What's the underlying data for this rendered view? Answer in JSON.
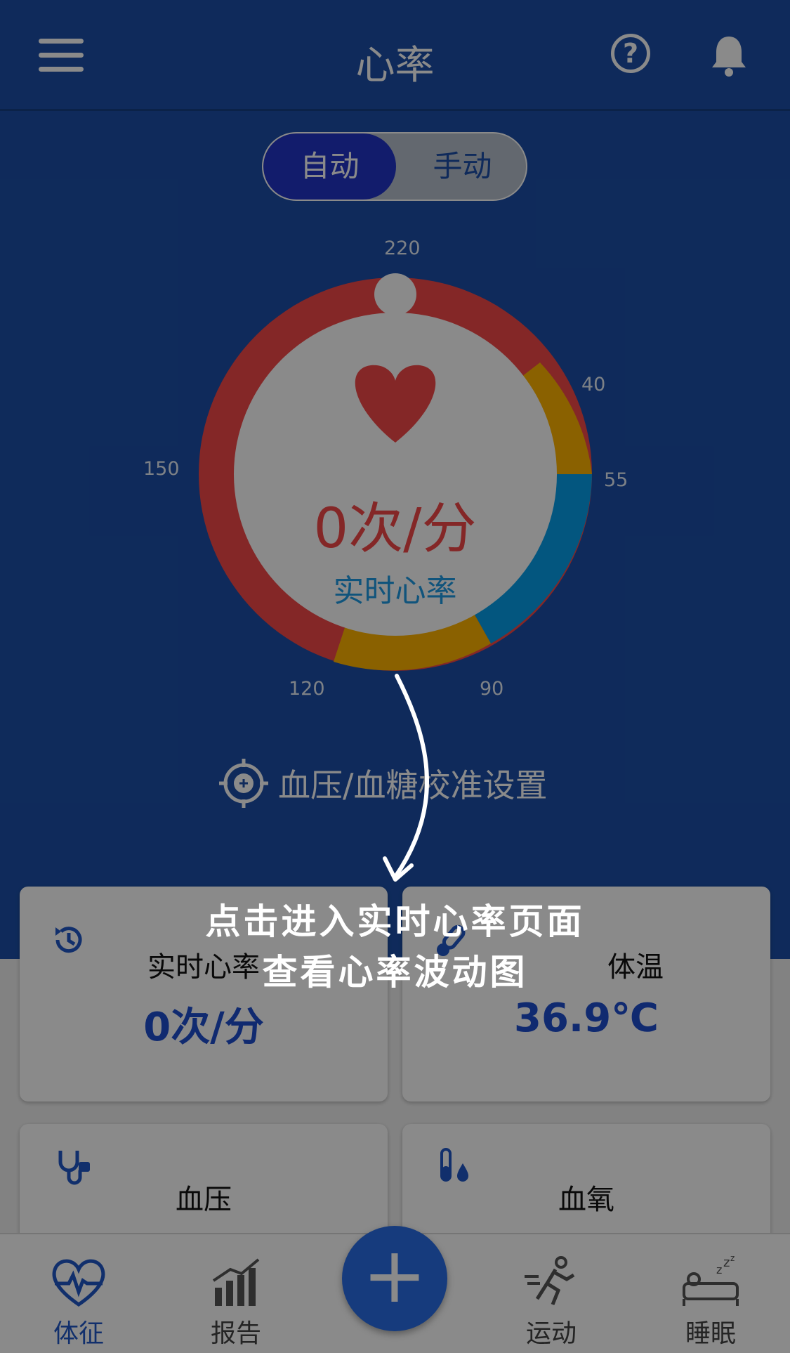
{
  "header": {
    "title": "心率"
  },
  "mode_toggle": {
    "auto_label": "自动",
    "manual_label": "手动",
    "selected": "自动"
  },
  "gauge": {
    "labels": {
      "top": "220",
      "right_upper": "40",
      "right": "55",
      "bottom_right": "90",
      "bottom_left": "120",
      "left": "150"
    },
    "value": "0次/分",
    "caption": "实时心率",
    "colors": {
      "high": "#f44848",
      "medium": "#ffb300",
      "normal": "#07a0ea",
      "center": "#ffffff"
    }
  },
  "calibration": {
    "label": "血压/血糖校准设置"
  },
  "cards": [
    {
      "label": "实时心率",
      "value": "0次/分",
      "icon": "history-icon"
    },
    {
      "label": "体温",
      "value": "36.9℃",
      "icon": "thermometer-icon"
    },
    {
      "label": "血压",
      "value": "",
      "icon": "stethoscope-icon"
    },
    {
      "label": "血氧",
      "value": "",
      "icon": "sao2-icon"
    }
  ],
  "bottom_nav": [
    {
      "label": "体征",
      "icon": "heartbeat-icon",
      "active": true
    },
    {
      "label": "报告",
      "icon": "bar-chart-icon",
      "active": false
    },
    {
      "label": "",
      "icon": "plus-icon",
      "active": false
    },
    {
      "label": "运动",
      "icon": "running-icon",
      "active": false
    },
    {
      "label": "睡眠",
      "icon": "sleep-icon",
      "active": false
    }
  ],
  "guide": {
    "line1": "点击进入实时心率页面",
    "line2": "查看心率波动图"
  }
}
